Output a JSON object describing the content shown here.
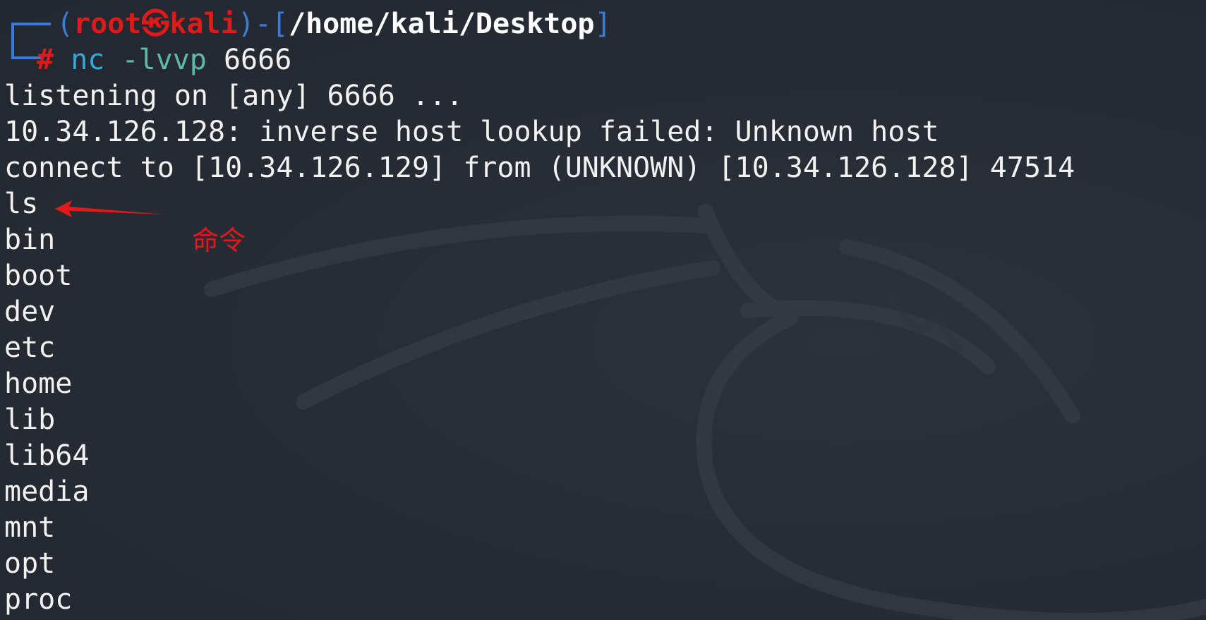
{
  "prompt": {
    "open_paren": "(",
    "user": "root",
    "host_symbol": "㉿",
    "host": "kali",
    "close_paren": ")",
    "dash": "-[",
    "path": "/home/kali/Desktop",
    "path_close": "]",
    "hash": "#",
    "command": "nc",
    "flags": "-lvvp",
    "port": "6666"
  },
  "output_lines": [
    "listening on [any] 6666 ...",
    "10.34.126.128: inverse host lookup failed: Unknown host",
    "connect to [10.34.126.129] from (UNKNOWN) [10.34.126.128] 47514",
    "ls",
    "bin",
    "boot",
    "dev",
    "etc",
    "home",
    "lib",
    "lib64",
    "media",
    "mnt",
    "opt",
    "proc"
  ],
  "annotation": {
    "label": "命令"
  },
  "colors": {
    "background": "#262a33",
    "prompt_blue": "#3a7bd5",
    "prompt_red": "#e0191b",
    "command_cyan": "#34a8d6",
    "annotation_red": "#e0191b"
  }
}
